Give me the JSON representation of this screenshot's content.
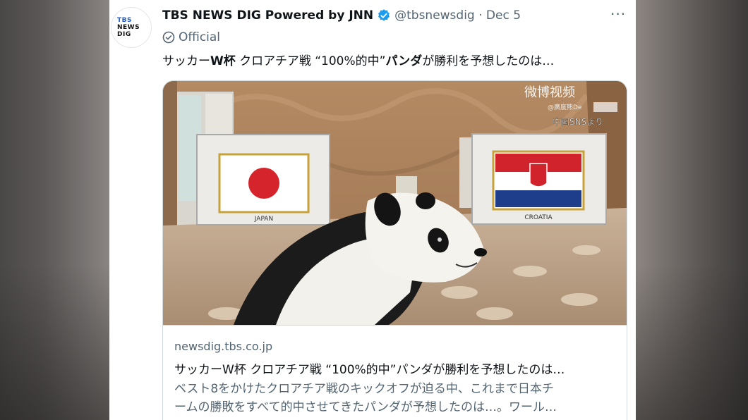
{
  "account": {
    "avatar_lines": [
      "TBS",
      "NEWS",
      "DIG"
    ],
    "display_name": "TBS NEWS DIG Powered by JNN",
    "handle_date": "@tbsnewsdig · Dec 5",
    "badge": "Official",
    "verified_color": "#1d9bf0"
  },
  "tweet": {
    "text_parts": [
      "サッカー",
      "W杯",
      " クロアチア戦 “100%的中”",
      "パンダ",
      "が勝利を予想したのは…"
    ],
    "more_label": "···"
  },
  "media": {
    "flag_left_label": "JAPAN",
    "flag_right_label": "CROATIA",
    "watermark_brand": "微博视频",
    "watermark_sub": "@廣度熊De",
    "watermark_source": "中国SNSより"
  },
  "card": {
    "domain": "newsdig.tbs.co.jp",
    "title": "サッカーW杯 クロアチア戦 “100%的中”パンダが勝利を予想したのは…",
    "description_line1": "ベスト8をかけたクロアチア戦のキックオフが迫る中、これまで日本チ",
    "description_line2": "ームの勝敗をすべて的中させてきたパンダが予想したのは…。ワール…"
  }
}
